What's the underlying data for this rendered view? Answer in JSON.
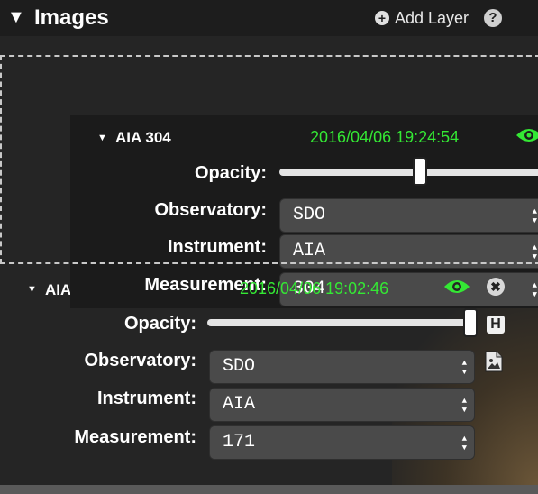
{
  "header": {
    "collapse_glyph": "▼",
    "title": "Images",
    "add_layer_label": "Add Layer",
    "add_icon_glyph": "+",
    "help_glyph": "?"
  },
  "ghost_layer": {
    "name": "AIA 304",
    "timestamp": "2016/04/06 19:24:54",
    "opacity": 0.52,
    "opacity_label": "Opacity:",
    "observatory_label": "Observatory:",
    "observatory_value": "SDO",
    "instrument_label": "Instrument:",
    "instrument_value": "AIA",
    "measurement_label": "Measurement:",
    "measurement_value": "304"
  },
  "layer": {
    "name": "AIA 171",
    "timestamp": "2016/04/06 19:02:46",
    "opacity": 1.0,
    "opacity_label": "Opacity:",
    "observatory_label": "Observatory:",
    "observatory_value": "SDO",
    "instrument_label": "Instrument:",
    "instrument_value": "AIA",
    "measurement_label": "Measurement:",
    "measurement_value": "171",
    "close_glyph": "✖",
    "hide_glyph": "H"
  },
  "colors": {
    "timestamp": "#34e834",
    "eye": "#34e834",
    "panel": "#252525"
  },
  "icons": [
    "collapse-arrow-icon",
    "plus-circle-icon",
    "help-icon",
    "eye-icon",
    "close-icon",
    "hide-icon",
    "file-image-icon"
  ]
}
